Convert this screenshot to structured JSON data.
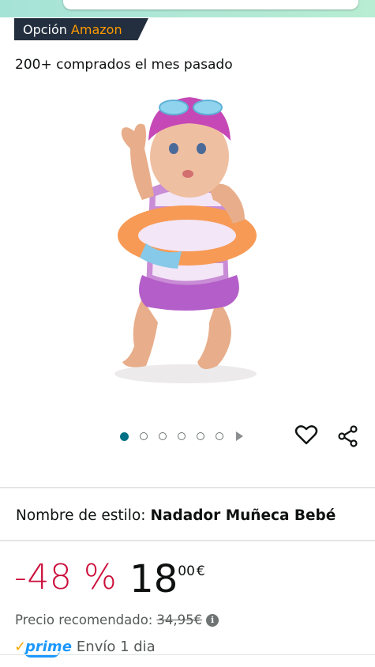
{
  "badge": {
    "label": "Opción",
    "brand": "Amazon"
  },
  "purchased_text": "200+ comprados el mes pasado",
  "image": {
    "icon": "doll-swimmer-image",
    "dots_count": 6,
    "active_dot": 0
  },
  "style": {
    "label": "Nombre de estilo:",
    "value": "Nadador Muñeca Bebé"
  },
  "price": {
    "discount": "-48 %",
    "integer": "18",
    "decimal": "00",
    "currency": "€"
  },
  "recommended": {
    "label": "Precio recomendado:",
    "value": "34,95€"
  },
  "shipping": {
    "prime_label": "prime",
    "text": "Envío 1 dia"
  },
  "colors": {
    "discount": "#cc0c39",
    "badge_bg": "#232f3e",
    "brand": "#ff9900",
    "dot_active": "#007185"
  }
}
